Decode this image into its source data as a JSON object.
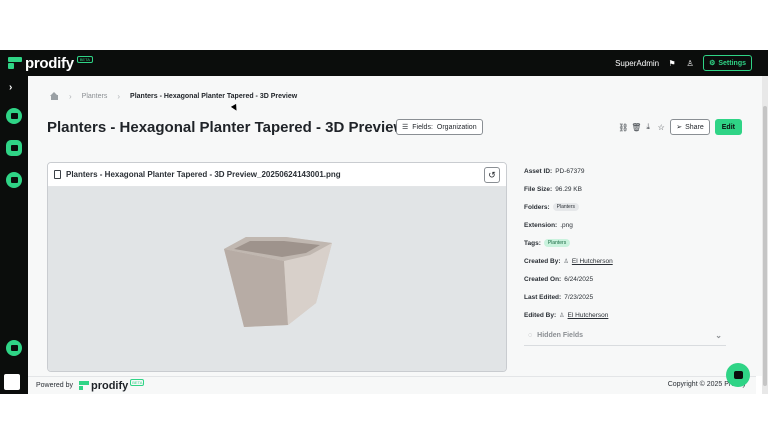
{
  "topbar": {
    "brand": "prodify",
    "beta_label": "BETA",
    "user": "SuperAdmin",
    "settings_label": "Settings"
  },
  "breadcrumb": {
    "items": [
      "Planters",
      "Planters - Hexagonal Planter Tapered - 3D Preview"
    ]
  },
  "page": {
    "title": "Planters - Hexagonal Planter Tapered - 3D Preview",
    "fields_label": "Fields:",
    "fields_value": "Organization",
    "share_label": "Share",
    "edit_label": "Edit"
  },
  "preview": {
    "filename": "Planters - Hexagonal Planter Tapered - 3D Preview_20250624143001.png"
  },
  "meta": {
    "asset_id_label": "Asset ID:",
    "asset_id": "PD-67379",
    "file_size_label": "File Size:",
    "file_size": "96.29 KB",
    "folders_label": "Folders:",
    "folder": "Planters",
    "extension_label": "Extension:",
    "extension": ".png",
    "tags_label": "Tags:",
    "tag": "Planters",
    "created_by_label": "Created By:",
    "created_by": "El Hutcherson",
    "created_on_label": "Created On:",
    "created_on": "6/24/2025",
    "last_edited_label": "Last Edited:",
    "last_edited": "7/23/2025",
    "edited_by_label": "Edited By:",
    "edited_by": "El Hutcherson",
    "hidden_fields_label": "Hidden Fields"
  },
  "footer": {
    "powered_by": "Powered by",
    "brand": "prodify",
    "beta_label": "BETA",
    "copyright": "Copyright © 2025 Prodify"
  },
  "colors": {
    "accent": "#2fd486",
    "topbar": "#0b0d0c",
    "preview_bg": "#e1e4e6",
    "planter": "#c9bfb8"
  }
}
